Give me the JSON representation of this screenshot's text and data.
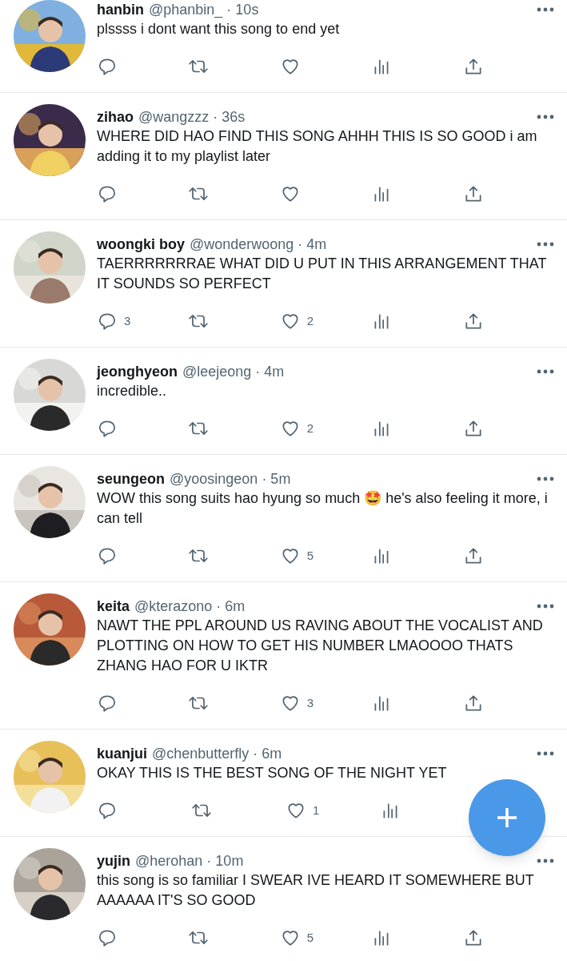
{
  "tweets": [
    {
      "name": "hanbin",
      "handle": "@phanbin_",
      "time": "· 10s",
      "text": "plssss i dont want this song to end yet",
      "share_icon": true
    },
    {
      "name": "zihao",
      "handle": "@wangzzz",
      "time": "· 36s",
      "text": "WHERE DID HAO FIND THIS SONG AHHH THIS IS SO GOOD i am adding it to my playlist later",
      "share_icon": true
    },
    {
      "name": "woongki boy",
      "handle": "@wonderwoong",
      "time": "· 4m",
      "text": "TAERRRRRRRAE WHAT DID U PUT IN THIS ARRANGEMENT THAT IT SOUNDS SO PERFECT",
      "replies": "3",
      "likes": "2",
      "share_icon": true
    },
    {
      "name": "jeonghyeon",
      "handle": "@leejeong",
      "time": "· 4m",
      "text": "incredible..",
      "likes": "2",
      "share_icon": true
    },
    {
      "name": "seungeon",
      "handle": "@yoosingeon",
      "time": "· 5m",
      "text": "WOW this song suits hao hyung so much 🤩 he's also feeling it more, i can tell",
      "likes": "5",
      "share_icon": true
    },
    {
      "name": "keita",
      "handle": "@kterazono",
      "time": "· 6m",
      "text": "NAWT THE PPL AROUND US RAVING ABOUT THE VOCALIST AND PLOTTING ON HOW TO GET HIS NUMBER LMAOOOO THATS ZHANG HAO FOR U IKTR",
      "likes": "3",
      "share_icon": true
    },
    {
      "name": "kuanjui",
      "handle": "@chenbutterfly",
      "time": "· 6m",
      "text": "OKAY THIS IS THE BEST SONG OF THE NIGHT YET",
      "likes": "1",
      "share_icon": false
    },
    {
      "name": "yujin",
      "handle": "@herohan",
      "time": "· 10m",
      "text": "this song is so familiar I SWEAR IVE HEARD IT SOMEWHERE BUT AAAAAA IT'S SO GOOD",
      "likes": "5",
      "share_icon": true
    }
  ]
}
